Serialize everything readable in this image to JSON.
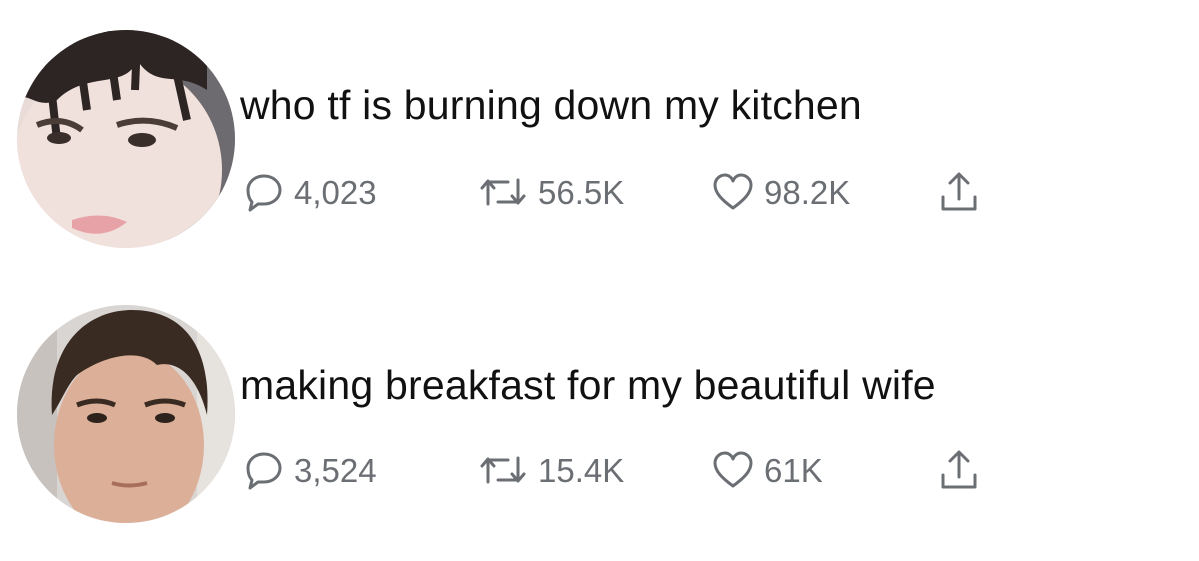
{
  "tweets": [
    {
      "text": "who tf is burning down my kitchen",
      "replies": "4,023",
      "retweets": "56.5K",
      "likes": "98.2K"
    },
    {
      "text": "making breakfast for my beautiful wife",
      "replies": "3,524",
      "retweets": "15.4K",
      "likes": "61K"
    }
  ],
  "icons": {
    "reply": "speech-bubble-icon",
    "retweet": "retweet-icon",
    "like": "heart-icon",
    "share": "share-icon"
  },
  "colors": {
    "text": "#111111",
    "muted": "#6b6f74",
    "background": "#ffffff"
  }
}
